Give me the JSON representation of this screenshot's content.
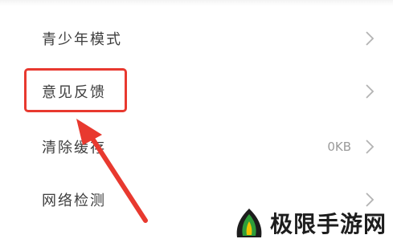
{
  "settings_list": {
    "items": [
      {
        "label": "青少年模式",
        "value": "",
        "icon": "chevron-right-icon"
      },
      {
        "label": "意见反馈",
        "value": "",
        "icon": "chevron-right-icon"
      },
      {
        "label": "清除缓存",
        "value": "0KB",
        "icon": "chevron-right-icon"
      },
      {
        "label": "网络检测",
        "value": "",
        "icon": "chevron-right-icon"
      }
    ]
  },
  "annotation": {
    "highlight_color": "#e8392f",
    "highlighted_item": "意见反馈"
  },
  "watermark": {
    "text": "极限手游网",
    "logo_colors": [
      "#1d1d1d",
      "#2e9e3a",
      "#f2c400"
    ]
  }
}
